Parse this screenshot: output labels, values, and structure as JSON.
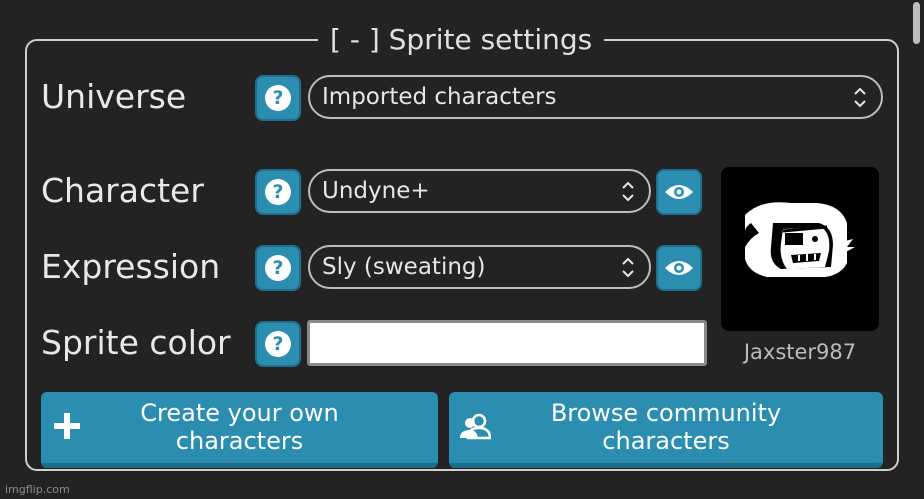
{
  "panel": {
    "legend": "[ - ] Sprite settings"
  },
  "rows": {
    "universe": {
      "label": "Universe",
      "value": "Imported characters"
    },
    "character": {
      "label": "Character",
      "value": "Undyne+"
    },
    "expression": {
      "label": "Expression",
      "value": "Sly (sweating)"
    },
    "sprite_color": {
      "label": "Sprite color",
      "value": "#ffffff"
    }
  },
  "help": {
    "glyph": "?"
  },
  "preview": {
    "author": "Jaxster987"
  },
  "buttons": {
    "create": {
      "label_line1": "Create your own",
      "label_line2": "characters",
      "icon": "plus-icon"
    },
    "browse": {
      "label_line1": "Browse community",
      "label_line2": "characters",
      "icon": "users-icon"
    }
  },
  "colors": {
    "accent": "#2b8db0",
    "background": "#232323"
  },
  "watermark": "imgflip.com"
}
